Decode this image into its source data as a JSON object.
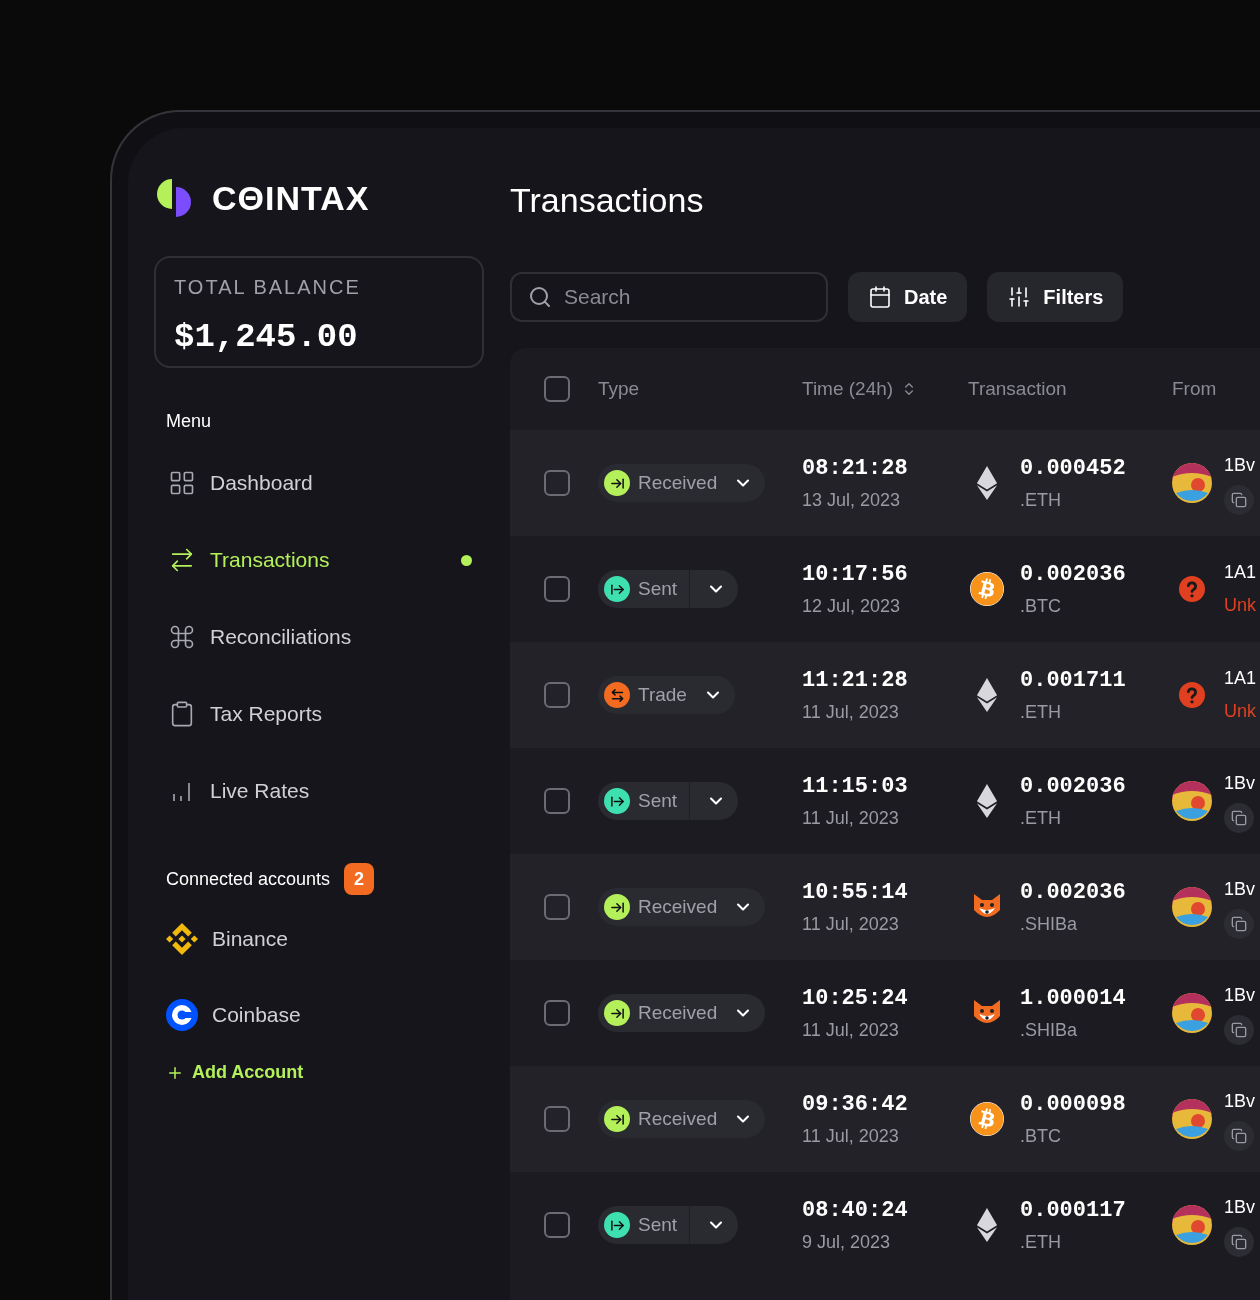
{
  "brand": {
    "name": "CΘINTAX"
  },
  "balance": {
    "label": "TOTAL BALANCE",
    "value": "$1,245.00"
  },
  "menu": {
    "title": "Menu",
    "items": [
      {
        "kind": "grid",
        "label": "Dashboard",
        "selected": false
      },
      {
        "kind": "arrows",
        "label": "Transactions",
        "selected": true
      },
      {
        "kind": "command",
        "label": "Reconciliations",
        "selected": false
      },
      {
        "kind": "clipboard",
        "label": "Tax Reports",
        "selected": false
      },
      {
        "kind": "bars",
        "label": "Live Rates",
        "selected": false
      }
    ]
  },
  "accounts": {
    "title": "Connected accounts",
    "count": "2",
    "items": [
      {
        "kind": "diamond",
        "label": "Binance"
      },
      {
        "kind": "ring",
        "label": "Coinbase"
      }
    ],
    "add_label": "Add Account"
  },
  "page_title": "Transactions",
  "toolbar": {
    "search_placeholder": "Search",
    "date_label": "Date",
    "filters_label": "Filters"
  },
  "table": {
    "select_all_checked": false,
    "columns": [
      "Type",
      "Time (24h)",
      "Transaction",
      "From"
    ],
    "rows": [
      {
        "checked": false,
        "type": {
          "kind": "received",
          "label": "Received"
        },
        "time": "08:21:28",
        "date": "13 Jul, 2023",
        "coin": {
          "kind": "eth",
          "amount": "0.000452",
          "unit": ".ETH"
        },
        "from": {
          "kind": "avatar",
          "address": "1Bv"
        }
      },
      {
        "checked": false,
        "type": {
          "kind": "sent",
          "label": "Sent"
        },
        "time": "10:17:56",
        "date": "12 Jul, 2023",
        "coin": {
          "kind": "btc",
          "amount": "0.002036",
          "unit": ".BTC"
        },
        "from": {
          "kind": "unknown",
          "address": "1A1",
          "note": "Unk"
        }
      },
      {
        "checked": false,
        "type": {
          "kind": "trade",
          "label": "Trade"
        },
        "time": "11:21:28",
        "date": "11 Jul, 2023",
        "coin": {
          "kind": "eth",
          "amount": "0.001711",
          "unit": ".ETH"
        },
        "from": {
          "kind": "unknown",
          "address": "1A1",
          "note": "Unk"
        }
      },
      {
        "checked": false,
        "type": {
          "kind": "sent",
          "label": "Sent"
        },
        "time": "11:15:03",
        "date": "11 Jul, 2023",
        "coin": {
          "kind": "eth",
          "amount": "0.002036",
          "unit": ".ETH"
        },
        "from": {
          "kind": "avatar",
          "address": "1Bv"
        }
      },
      {
        "checked": false,
        "type": {
          "kind": "received",
          "label": "Received"
        },
        "time": "10:55:14",
        "date": "11 Jul, 2023",
        "coin": {
          "kind": "shiba",
          "amount": "0.002036",
          "unit": ".SHIBa"
        },
        "from": {
          "kind": "avatar",
          "address": "1Bv"
        }
      },
      {
        "checked": false,
        "type": {
          "kind": "received",
          "label": "Received"
        },
        "time": "10:25:24",
        "date": "11 Jul, 2023",
        "coin": {
          "kind": "shiba",
          "amount": "1.000014",
          "unit": ".SHIBa"
        },
        "from": {
          "kind": "avatar",
          "address": "1Bv"
        }
      },
      {
        "checked": false,
        "type": {
          "kind": "received",
          "label": "Received"
        },
        "time": "09:36:42",
        "date": "11 Jul, 2023",
        "coin": {
          "kind": "btc",
          "amount": "0.000098",
          "unit": ".BTC"
        },
        "from": {
          "kind": "avatar",
          "address": "1Bv"
        }
      },
      {
        "checked": false,
        "type": {
          "kind": "sent",
          "label": "Sent"
        },
        "time": "08:40:24",
        "date": "9 Jul, 2023",
        "coin": {
          "kind": "eth",
          "amount": "0.000117",
          "unit": ".ETH"
        },
        "from": {
          "kind": "avatar",
          "address": "1Bv"
        }
      }
    ]
  }
}
